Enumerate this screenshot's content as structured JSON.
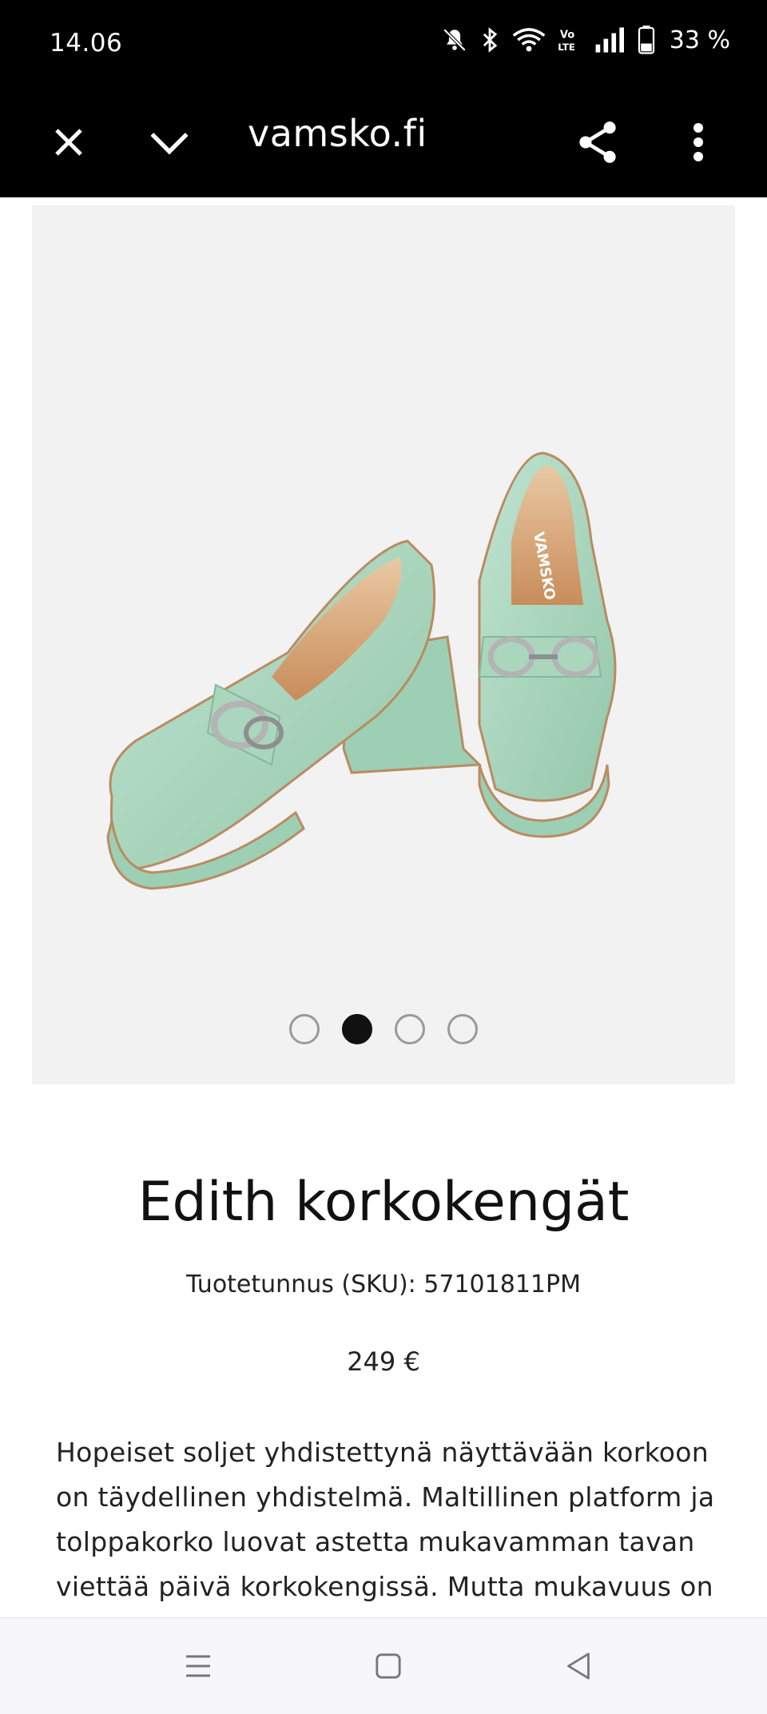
{
  "status_bar": {
    "time": "14.06",
    "battery": "33 %",
    "icons": [
      "mute-icon",
      "bluetooth-icon",
      "wifi-icon",
      "volte-icon",
      "signal-icon",
      "battery-icon"
    ]
  },
  "browser": {
    "url": "vamsko.fi",
    "icons": [
      "close-icon",
      "chevron-down-icon",
      "share-icon",
      "more-vert-icon"
    ]
  },
  "product": {
    "image_alt": "Mint green platform loafer heels",
    "carousel": {
      "count": 4,
      "active_index": 1
    },
    "title": "Edith korkokengät",
    "sku": "Tuotetunnus (SKU): 57101811PM",
    "price": "249 €",
    "description": "Hopeiset soljet yhdistettynä näyttävään korkoon on täydellinen yhdistelmä. Maltillinen platform ja tolppakorko luovat astetta mukavamman tavan viettää päivä korkokengissä. Mutta mukavuus on"
  },
  "nav": {
    "icons": [
      "recent-apps-icon",
      "home-icon",
      "back-icon"
    ]
  },
  "colors": {
    "shoe": "#a8d5bd",
    "background_image": "#f2f2f2",
    "bar": "#000000"
  }
}
